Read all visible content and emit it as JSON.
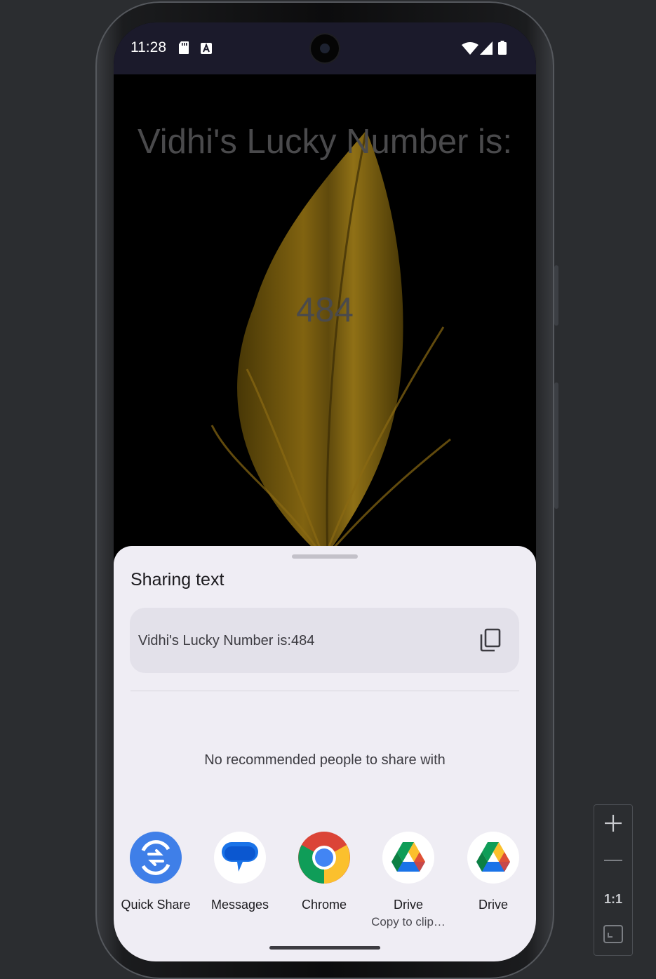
{
  "status_bar": {
    "time": "11:28",
    "left_icons": [
      "sd-card-icon",
      "text-a-icon"
    ],
    "right_icons": [
      "wifi-icon",
      "signal-icon",
      "battery-icon"
    ]
  },
  "app": {
    "title": "Vidhi's Lucky Number is:",
    "number": "484"
  },
  "share_sheet": {
    "title": "Sharing text",
    "preview_text": "Vidhi's Lucky Number is:484",
    "copy_icon": "copy-icon",
    "empty_message": "No recommended people to share with",
    "targets": [
      {
        "label": "Quick Share",
        "sublabel": "",
        "icon": "quick-share-icon"
      },
      {
        "label": "Messages",
        "sublabel": "",
        "icon": "messages-icon"
      },
      {
        "label": "Chrome",
        "sublabel": "",
        "icon": "chrome-icon"
      },
      {
        "label": "Drive",
        "sublabel": "Copy to clip…",
        "icon": "drive-icon"
      },
      {
        "label": "Drive",
        "sublabel": "",
        "icon": "drive-icon"
      }
    ]
  },
  "zoom_controls": {
    "zoom_in_icon": "plus-icon",
    "zoom_out_icon": "minus-icon",
    "actual_size_label": "1:1",
    "fit_icon": "fit-screen-icon"
  },
  "colors": {
    "sheet_background": "#efedf4",
    "status_bar": "#1b1a2b",
    "quick_share_blue": "#3f7fe8",
    "feather_gold": "#c49a1c"
  }
}
